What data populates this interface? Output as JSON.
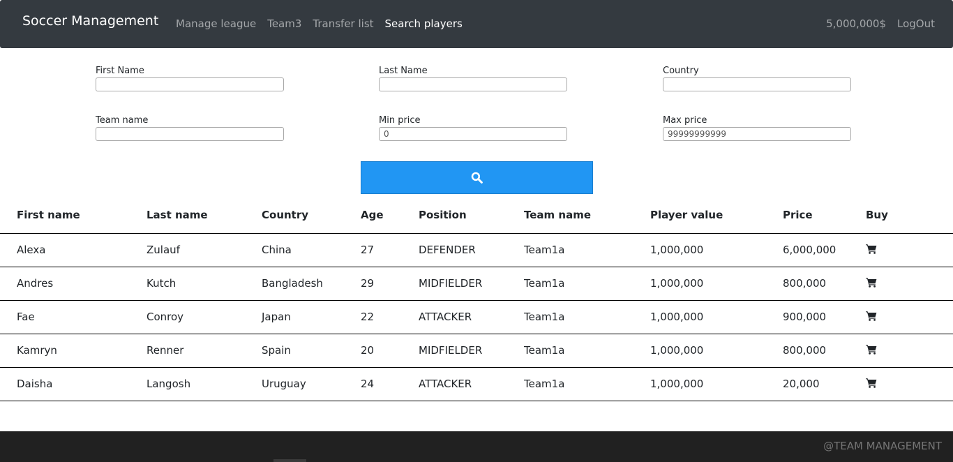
{
  "navbar": {
    "brand": "Soccer Management",
    "links": [
      "Manage league",
      "Team3",
      "Transfer list",
      "Search players"
    ],
    "active_link": "Search players",
    "balance": "5,000,000$",
    "logout": "LogOut"
  },
  "search": {
    "first_name_label": "First Name",
    "first_name_value": "",
    "last_name_label": "Last Name",
    "last_name_value": "",
    "country_label": "Country",
    "country_value": "",
    "team_name_label": "Team name",
    "team_name_value": "",
    "min_price_label": "Min price",
    "min_price_value": "0",
    "max_price_label": "Max price",
    "max_price_value": "99999999999",
    "button_icon": "search-icon",
    "button_color": "#2196f3"
  },
  "table": {
    "headers": [
      "First name",
      "Last name",
      "Country",
      "Age",
      "Position",
      "Team name",
      "Player value",
      "Price",
      "Buy"
    ],
    "rows": [
      [
        "Alexa",
        "Zulauf",
        "China",
        "27",
        "DEFENDER",
        "Team1a",
        "1,000,000",
        "6,000,000"
      ],
      [
        "Andres",
        "Kutch",
        "Bangladesh",
        "29",
        "MIDFIELDER",
        "Team1a",
        "1,000,000",
        "800,000"
      ],
      [
        "Fae",
        "Conroy",
        "Japan",
        "22",
        "ATTACKER",
        "Team1a",
        "1,000,000",
        "900,000"
      ],
      [
        "Kamryn",
        "Renner",
        "Spain",
        "20",
        "MIDFIELDER",
        "Team1a",
        "1,000,000",
        "800,000"
      ],
      [
        "Daisha",
        "Langosh",
        "Uruguay",
        "24",
        "ATTACKER",
        "Team1a",
        "1,000,000",
        "20,000"
      ]
    ],
    "buy_icon": "cart-icon"
  },
  "footer": {
    "text": "@TEAM MANAGEMENT"
  },
  "colors": {
    "navbar_bg": "#343a40",
    "footer_bg": "#212121",
    "accent": "#2196f3"
  }
}
